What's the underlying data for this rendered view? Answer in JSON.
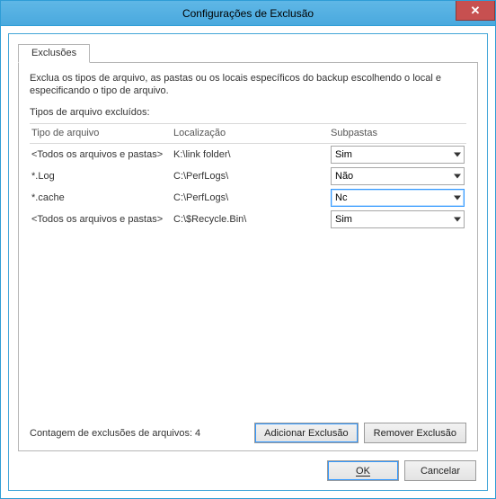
{
  "window": {
    "title": "Configurações de Exclusão",
    "close_glyph": "✕"
  },
  "tabs": {
    "exclusions_label": "Exclusões"
  },
  "panel": {
    "description": "Exclua os tipos de arquivo, as pastas ou os locais específicos do backup escolhendo o local e especificando o tipo de arquivo.",
    "subhead": "Tipos de arquivo excluídos:"
  },
  "grid": {
    "headers": {
      "type": "Tipo de arquivo",
      "location": "Localização",
      "subfolders": "Subpastas"
    },
    "placeholder_all": "<Todos os arquivos e pastas>",
    "rows": [
      {
        "type_is_placeholder": true,
        "type": "<Todos os arquivos e pastas>",
        "location": "K:\\link folder\\",
        "subfolders": "Sim",
        "active": false
      },
      {
        "type_is_placeholder": false,
        "type": "*.Log",
        "location": "C:\\PerfLogs\\",
        "subfolders": "Não",
        "active": false
      },
      {
        "type_is_placeholder": false,
        "type": "*.cache",
        "location": "C:\\PerfLogs\\",
        "subfolders": "Nc",
        "active": true
      },
      {
        "type_is_placeholder": true,
        "type": "<Todos os arquivos e pastas>",
        "location": "C:\\$Recycle.Bin\\",
        "subfolders": "Sim",
        "active": false
      }
    ]
  },
  "footer": {
    "count_label": "Contagem de exclusões de arquivos: 4",
    "add_label": "Adicionar Exclusão",
    "remove_label": "Remover Exclusão"
  },
  "dialog": {
    "ok_label": "OK",
    "cancel_label": "Cancelar"
  }
}
